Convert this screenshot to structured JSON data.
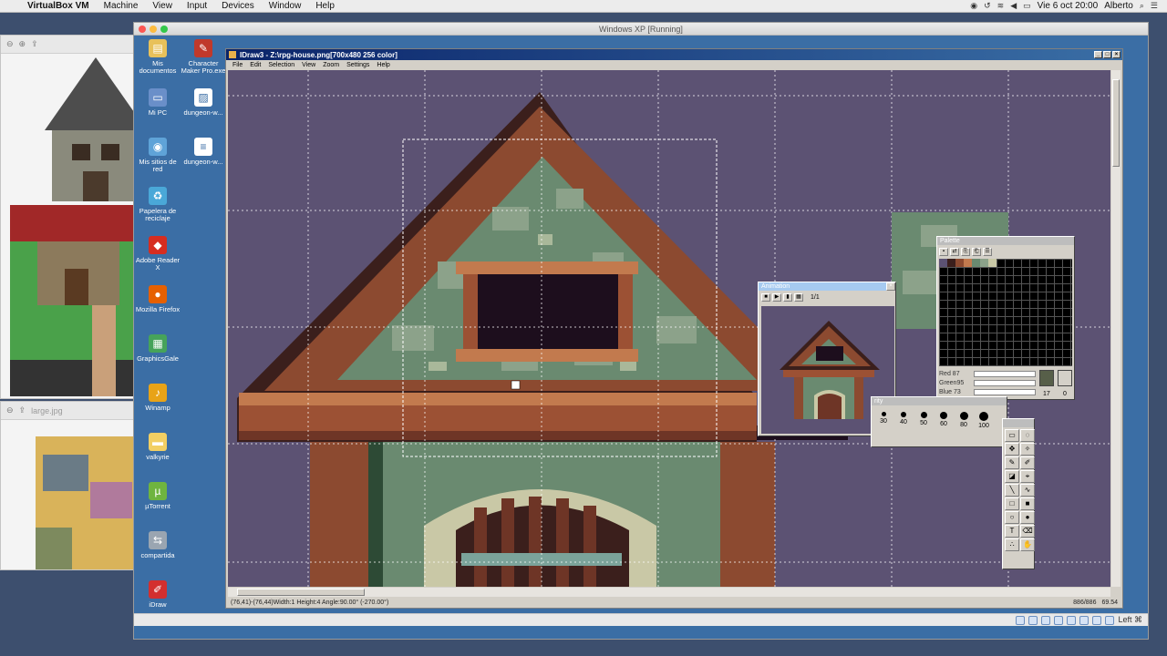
{
  "mac_menubar": {
    "app_name": "VirtualBox VM",
    "menus": [
      "Machine",
      "View",
      "Input",
      "Devices",
      "Window",
      "Help"
    ],
    "clock": "Vie 6 oct  20:00",
    "user": "Alberto"
  },
  "background_windows": {
    "second_title": "large.jpg"
  },
  "vbox": {
    "title": "Windows XP [Running]",
    "taskbar_right": "Left ⌘"
  },
  "desktop_icons": [
    {
      "label": "Mis documentos",
      "icon": "folder-documents-icon",
      "color": "#e8c15a"
    },
    {
      "label": "Character Maker Pro.exe",
      "icon": "app-exe-icon",
      "color": "#c0392b"
    },
    {
      "label": "Mi PC",
      "icon": "computer-icon",
      "color": "#6a8fc9"
    },
    {
      "label": "dungeon-w...",
      "icon": "image-file-icon",
      "color": "#ffffff"
    },
    {
      "label": "Mis sitios de red",
      "icon": "network-icon",
      "color": "#5fa3d8"
    },
    {
      "label": "dungeon-w...",
      "icon": "text-file-icon",
      "color": "#ffffff"
    },
    {
      "label": "Papelera de reciclaje",
      "icon": "recycle-bin-icon",
      "color": "#4aa8d8"
    },
    {
      "label": "Adobe Reader X",
      "icon": "pdf-icon",
      "color": "#d62d20"
    },
    {
      "label": "Mozilla Firefox",
      "icon": "firefox-icon",
      "color": "#e66000"
    },
    {
      "label": "GraphicsGale",
      "icon": "graphicsgale-icon",
      "color": "#46a35a"
    },
    {
      "label": "Winamp",
      "icon": "winamp-icon",
      "color": "#e8a317"
    },
    {
      "label": "valkyrie",
      "icon": "folder-icon",
      "color": "#f2cf63"
    },
    {
      "label": "µTorrent",
      "icon": "utorrent-icon",
      "color": "#6fb43f"
    },
    {
      "label": "compartida",
      "icon": "shared-folder-icon",
      "color": "#9aa5b1"
    },
    {
      "label": "iDraw",
      "icon": "idraw-icon",
      "color": "#d32f2f"
    }
  ],
  "idraw": {
    "title": "IDraw3 - Z:\\rpg-house.png[700x480 256 color]",
    "menus": [
      "File",
      "Edit",
      "Selection",
      "View",
      "Zoom",
      "Settings",
      "Help"
    ],
    "status_left": "(76,41)-(76,44)Width:1 Height:4 Angle:90.00° (-270.00°)",
    "status_zoom": "886/886",
    "status_pos": "69.54"
  },
  "animation": {
    "title": "Animation",
    "frame": "1/1"
  },
  "palette": {
    "title": "Palette",
    "red_label": "Red",
    "red": "87",
    "green_label": "Green",
    "green": "95",
    "blue_label": "Blue",
    "blue": "73",
    "index": "17",
    "alpha": "0"
  },
  "brush": {
    "title": "rity",
    "sizes": [
      "30",
      "40",
      "50",
      "60",
      "80",
      "100"
    ]
  },
  "colors": {
    "canvas_bg": "#5c5273",
    "xp_blue": "#3b6ea5",
    "roof_dark": "#5a2b21",
    "roof_mid": "#9c5134",
    "stone": "#6a8a70"
  }
}
